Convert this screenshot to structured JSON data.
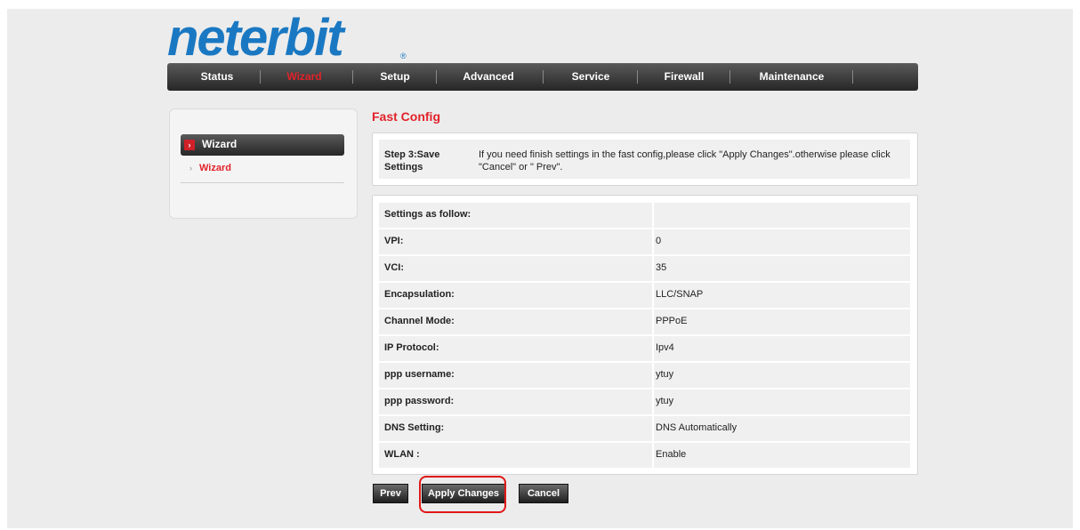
{
  "logo": {
    "text": "neterbit",
    "reg": "®"
  },
  "nav": {
    "items": [
      {
        "label": "Status",
        "active": false
      },
      {
        "label": "Wizard",
        "active": true
      },
      {
        "label": "Setup",
        "active": false
      },
      {
        "label": "Advanced",
        "active": false
      },
      {
        "label": "Service",
        "active": false
      },
      {
        "label": "Firewall",
        "active": false
      },
      {
        "label": "Maintenance",
        "active": false
      }
    ]
  },
  "sidebar": {
    "header": "Wizard",
    "items": [
      {
        "label": "Wizard"
      }
    ]
  },
  "main": {
    "title": "Fast Config",
    "step": {
      "label": "Step 3:Save Settings",
      "text": "If you need finish settings in the fast config,please click \"Apply Changes\".otherwise please click \"Cancel\" or \" Prev\"."
    },
    "settings": {
      "header": "Settings as follow:",
      "rows": [
        {
          "label": "VPI:",
          "value": "0"
        },
        {
          "label": "VCI:",
          "value": "35"
        },
        {
          "label": "Encapsulation:",
          "value": "LLC/SNAP"
        },
        {
          "label": "Channel Mode:",
          "value": "PPPoE"
        },
        {
          "label": "IP Protocol:",
          "value": "Ipv4"
        },
        {
          "label": "ppp username:",
          "value": "ytuy"
        },
        {
          "label": "ppp password:",
          "value": "ytuy"
        },
        {
          "label": "DNS Setting:",
          "value": "DNS Automatically"
        },
        {
          "label": "WLAN :",
          "value": "Enable"
        }
      ]
    },
    "buttons": {
      "prev": "Prev",
      "apply": "Apply Changes",
      "cancel": "Cancel"
    }
  },
  "colors": {
    "accent_red": "#e2222a",
    "brand_blue": "#1a78c2",
    "highlight_red": "#e01818"
  }
}
